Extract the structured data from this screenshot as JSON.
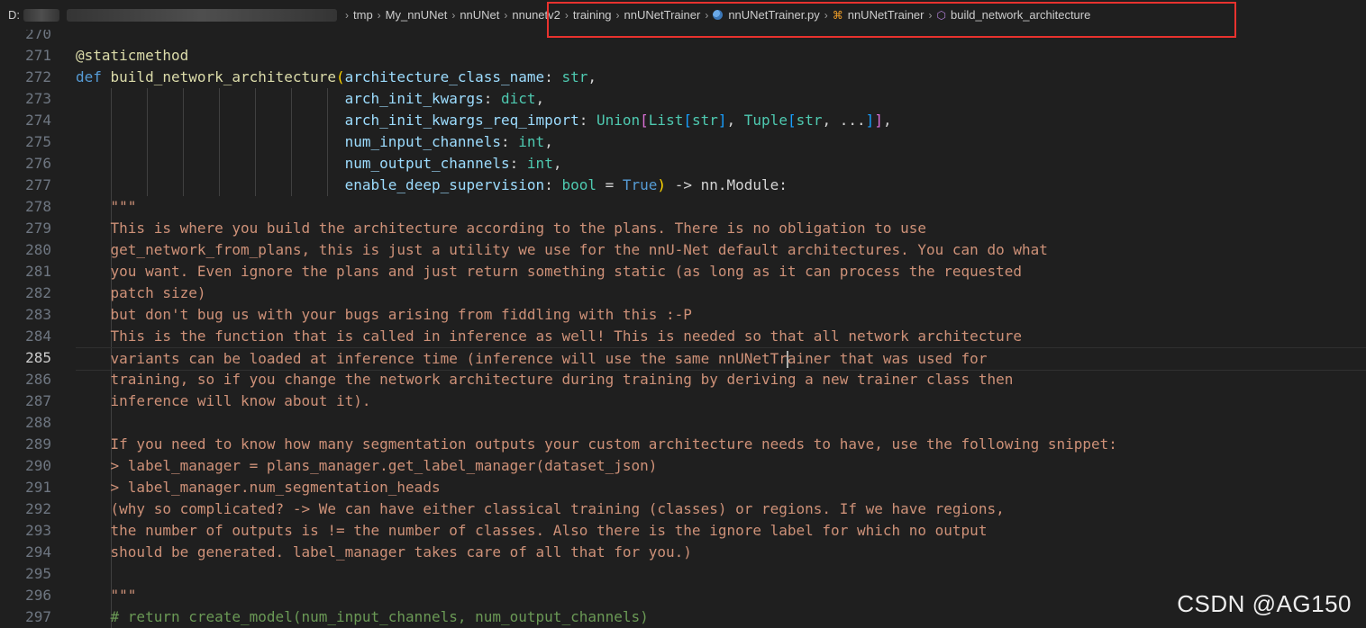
{
  "breadcrumb": {
    "drive": "D:",
    "items": [
      "tmp",
      "My_nnUNet",
      "nnUNet",
      "nnunetv2",
      "training",
      "nnUNetTrainer"
    ],
    "file": "nnUNetTrainer.py",
    "class": "nnUNetTrainer",
    "method": "build_network_architecture",
    "separator": "›"
  },
  "editor": {
    "current_line": 285,
    "lines": [
      {
        "n": "270",
        "tokens": []
      },
      {
        "n": "271",
        "tokens": [
          [
            "dec",
            "@staticmethod"
          ]
        ]
      },
      {
        "n": "272",
        "tokens": [
          [
            "kw",
            "def "
          ],
          [
            "fn",
            "build_network_architecture"
          ],
          [
            "b1",
            "("
          ],
          [
            "param",
            "architecture_class_name"
          ],
          [
            "plain",
            ": "
          ],
          [
            "type",
            "str"
          ],
          [
            "plain",
            ","
          ]
        ]
      },
      {
        "n": "273",
        "tokens": [
          [
            "pad",
            "                               "
          ],
          [
            "param",
            "arch_init_kwargs"
          ],
          [
            "plain",
            ": "
          ],
          [
            "type",
            "dict"
          ],
          [
            "plain",
            ","
          ]
        ]
      },
      {
        "n": "274",
        "tokens": [
          [
            "pad",
            "                               "
          ],
          [
            "param",
            "arch_init_kwargs_req_import"
          ],
          [
            "plain",
            ": "
          ],
          [
            "type",
            "Union"
          ],
          [
            "b2",
            "["
          ],
          [
            "type",
            "List"
          ],
          [
            "b3",
            "["
          ],
          [
            "type",
            "str"
          ],
          [
            "b3",
            "]"
          ],
          [
            "plain",
            ", "
          ],
          [
            "type",
            "Tuple"
          ],
          [
            "b3",
            "["
          ],
          [
            "type",
            "str"
          ],
          [
            "plain",
            ", ..."
          ],
          [
            "b3",
            "]"
          ],
          [
            "b2",
            "]"
          ],
          [
            "plain",
            ","
          ]
        ]
      },
      {
        "n": "275",
        "tokens": [
          [
            "pad",
            "                               "
          ],
          [
            "param",
            "num_input_channels"
          ],
          [
            "plain",
            ": "
          ],
          [
            "type",
            "int"
          ],
          [
            "plain",
            ","
          ]
        ]
      },
      {
        "n": "276",
        "tokens": [
          [
            "pad",
            "                               "
          ],
          [
            "param",
            "num_output_channels"
          ],
          [
            "plain",
            ": "
          ],
          [
            "type",
            "int"
          ],
          [
            "plain",
            ","
          ]
        ]
      },
      {
        "n": "277",
        "tokens": [
          [
            "pad",
            "                               "
          ],
          [
            "param",
            "enable_deep_supervision"
          ],
          [
            "plain",
            ": "
          ],
          [
            "type",
            "bool"
          ],
          [
            "plain",
            " = "
          ],
          [
            "kw",
            "True"
          ],
          [
            "b1",
            ")"
          ],
          [
            "plain",
            " -> nn.Module:"
          ]
        ]
      },
      {
        "n": "278",
        "tokens": [
          [
            "pad",
            "    "
          ],
          [
            "str",
            "\"\"\""
          ]
        ]
      },
      {
        "n": "279",
        "tokens": [
          [
            "pad",
            "    "
          ],
          [
            "str",
            "This is where you build the architecture according to the plans. There is no obligation to use"
          ]
        ]
      },
      {
        "n": "280",
        "tokens": [
          [
            "pad",
            "    "
          ],
          [
            "str",
            "get_network_from_plans, this is just a utility we use for the nnU-Net default architectures. You can do what"
          ]
        ]
      },
      {
        "n": "281",
        "tokens": [
          [
            "pad",
            "    "
          ],
          [
            "str",
            "you want. Even ignore the plans and just return something static (as long as it can process the requested"
          ]
        ]
      },
      {
        "n": "282",
        "tokens": [
          [
            "pad",
            "    "
          ],
          [
            "str",
            "patch size)"
          ]
        ]
      },
      {
        "n": "283",
        "tokens": [
          [
            "pad",
            "    "
          ],
          [
            "str",
            "but don't bug us with your bugs arising from fiddling with this :-P"
          ]
        ]
      },
      {
        "n": "284",
        "tokens": [
          [
            "pad",
            "    "
          ],
          [
            "str",
            "This is the function that is called in inference as well! This is needed so that all network architecture"
          ]
        ]
      },
      {
        "n": "285",
        "tokens": [
          [
            "pad",
            "    "
          ],
          [
            "str",
            "variants can be loaded at inference time (inference will use the same nnUNetTr"
          ],
          [
            "cursor",
            ""
          ],
          [
            "str",
            "ainer that was used for"
          ]
        ]
      },
      {
        "n": "286",
        "tokens": [
          [
            "pad",
            "    "
          ],
          [
            "str",
            "training, so if you change the network architecture during training by deriving a new trainer class then"
          ]
        ]
      },
      {
        "n": "287",
        "tokens": [
          [
            "pad",
            "    "
          ],
          [
            "str",
            "inference will know about it)."
          ]
        ]
      },
      {
        "n": "288",
        "tokens": []
      },
      {
        "n": "289",
        "tokens": [
          [
            "pad",
            "    "
          ],
          [
            "str",
            "If you need to know how many segmentation outputs your custom architecture needs to have, use the following snippet:"
          ]
        ]
      },
      {
        "n": "290",
        "tokens": [
          [
            "pad",
            "    "
          ],
          [
            "str",
            "> label_manager = plans_manager.get_label_manager(dataset_json)"
          ]
        ]
      },
      {
        "n": "291",
        "tokens": [
          [
            "pad",
            "    "
          ],
          [
            "str",
            "> label_manager.num_segmentation_heads"
          ]
        ]
      },
      {
        "n": "292",
        "tokens": [
          [
            "pad",
            "    "
          ],
          [
            "str",
            "(why so complicated? -> We can have either classical training (classes) or regions. If we have regions,"
          ]
        ]
      },
      {
        "n": "293",
        "tokens": [
          [
            "pad",
            "    "
          ],
          [
            "str",
            "the number of outputs is != the number of classes. Also there is the ignore label for which no output"
          ]
        ]
      },
      {
        "n": "294",
        "tokens": [
          [
            "pad",
            "    "
          ],
          [
            "str",
            "should be generated. label_manager takes care of all that for you.)"
          ]
        ]
      },
      {
        "n": "295",
        "tokens": []
      },
      {
        "n": "296",
        "tokens": [
          [
            "pad",
            "    "
          ],
          [
            "str",
            "\"\"\""
          ]
        ]
      },
      {
        "n": "297",
        "tokens": [
          [
            "pad",
            "    "
          ],
          [
            "cmt",
            "# return create_model(num_input_channels, num_output_channels)"
          ]
        ]
      }
    ]
  },
  "watermark": "CSDN @AG150",
  "colors": {
    "background": "#1f1f1f",
    "highlight_box": "#e8322e",
    "string": "#ce9178",
    "keyword": "#569cd6"
  }
}
